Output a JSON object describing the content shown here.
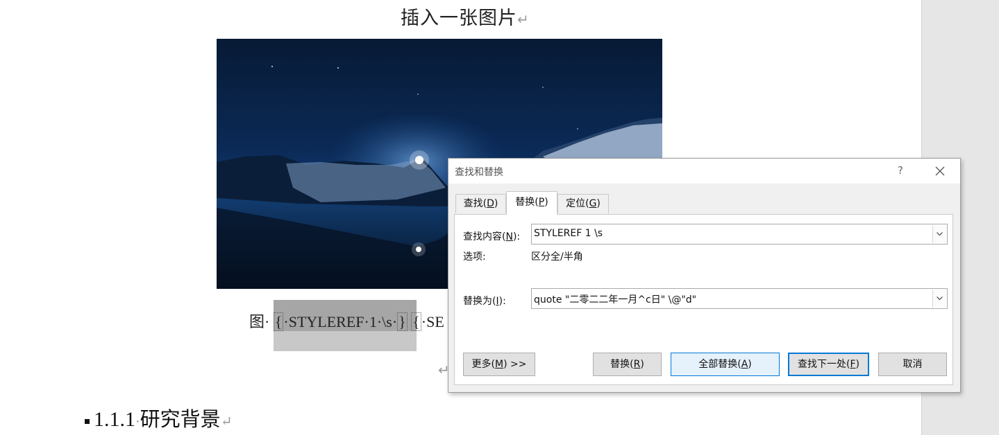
{
  "document": {
    "heading": "插入一张图片",
    "paragraph_mark": "↵",
    "caption": {
      "prefix": "图·",
      "field1_open": "{",
      "field1_code": "·STYLEREF·1·\\s·",
      "field1_close": "}",
      "field2_open": "{",
      "field2_code": "·SE"
    },
    "section_heading": {
      "number": "1.1.1",
      "separator": "·",
      "title": "研究背景"
    }
  },
  "dialog": {
    "title": "查找和替换",
    "help_label": "?",
    "tabs": [
      {
        "label": "查找(",
        "key": "D",
        "suffix": ")",
        "active": false
      },
      {
        "label": "替换(",
        "key": "P",
        "suffix": ")",
        "active": true
      },
      {
        "label": "定位(",
        "key": "G",
        "suffix": ")",
        "active": false
      }
    ],
    "find": {
      "label": "查找内容(",
      "key": "N",
      "suffix": "):",
      "value": "STYLEREF 1 \\s"
    },
    "options": {
      "label": "选项:",
      "value": "区分全/半角"
    },
    "replace": {
      "label": "替换为(",
      "key": "I",
      "suffix": "):",
      "value": "quote \"二零二二年一月^c日\" \\@\"d\""
    },
    "buttons": {
      "more": {
        "label": "更多(",
        "key": "M",
        "suffix": ") >>"
      },
      "replace": {
        "label": "替换(",
        "key": "R",
        "suffix": ")"
      },
      "replace_all": {
        "label": "全部替换(",
        "key": "A",
        "suffix": ")"
      },
      "find_next": {
        "label": "查找下一处(",
        "key": "F",
        "suffix": ")"
      },
      "cancel": {
        "label": "取消"
      }
    }
  },
  "colors": {
    "accent": "#0078d7",
    "field_shading": "#a6a6a6",
    "dialog_bg": "#f0f0f0"
  }
}
